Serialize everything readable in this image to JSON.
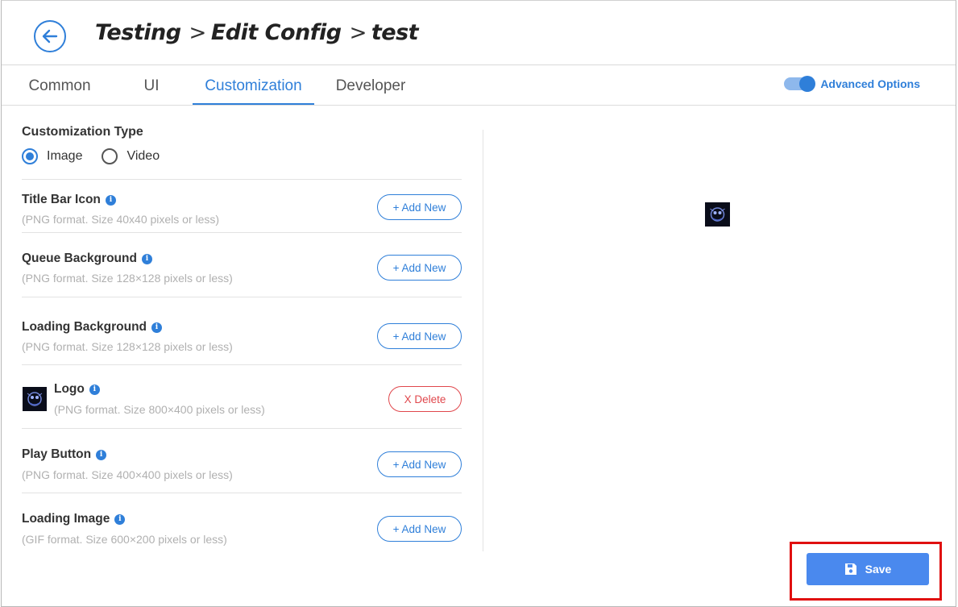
{
  "header": {
    "breadcrumb": [
      "Testing",
      "Edit Config",
      "test"
    ],
    "separator": ">"
  },
  "tabs": [
    {
      "label": "Common",
      "active": false
    },
    {
      "label": "UI",
      "active": false
    },
    {
      "label": "Customization",
      "active": true
    },
    {
      "label": "Developer",
      "active": false
    }
  ],
  "advanced_options": {
    "label": "Advanced Options",
    "enabled": true
  },
  "customization": {
    "type_title": "Customization Type",
    "options": [
      {
        "label": "Image",
        "checked": true
      },
      {
        "label": "Video",
        "checked": false
      }
    ],
    "items": [
      {
        "title": "Title Bar Icon",
        "desc": "(PNG format. Size 40x40 pixels or less)",
        "action": "+ Add New",
        "has_image": false
      },
      {
        "title": "Queue Background",
        "desc": "(PNG format. Size 128×128 pixels or less)",
        "action": "+ Add New",
        "has_image": false
      },
      {
        "title": "Loading Background",
        "desc": "(PNG format. Size 128×128 pixels or less)",
        "action": "+ Add New",
        "has_image": false
      },
      {
        "title": "Logo",
        "desc": "(PNG format. Size 800×400 pixels or less)",
        "action": "X Delete",
        "has_image": true
      },
      {
        "title": "Play Button",
        "desc": "(PNG format. Size 400×400 pixels or less)",
        "action": "+ Add New",
        "has_image": false
      },
      {
        "title": "Loading Image",
        "desc": "(GIF format. Size 600×200 pixels or less)",
        "action": "+ Add New",
        "has_image": false
      }
    ]
  },
  "save_label": "Save",
  "icons": {
    "back": "arrow-left-icon",
    "info": "info-icon",
    "save": "floppy-disk-icon"
  },
  "colors": {
    "accent": "#2f7fd9",
    "danger": "#e0474c",
    "save": "#4a89ee",
    "highlight": "#e01010"
  }
}
